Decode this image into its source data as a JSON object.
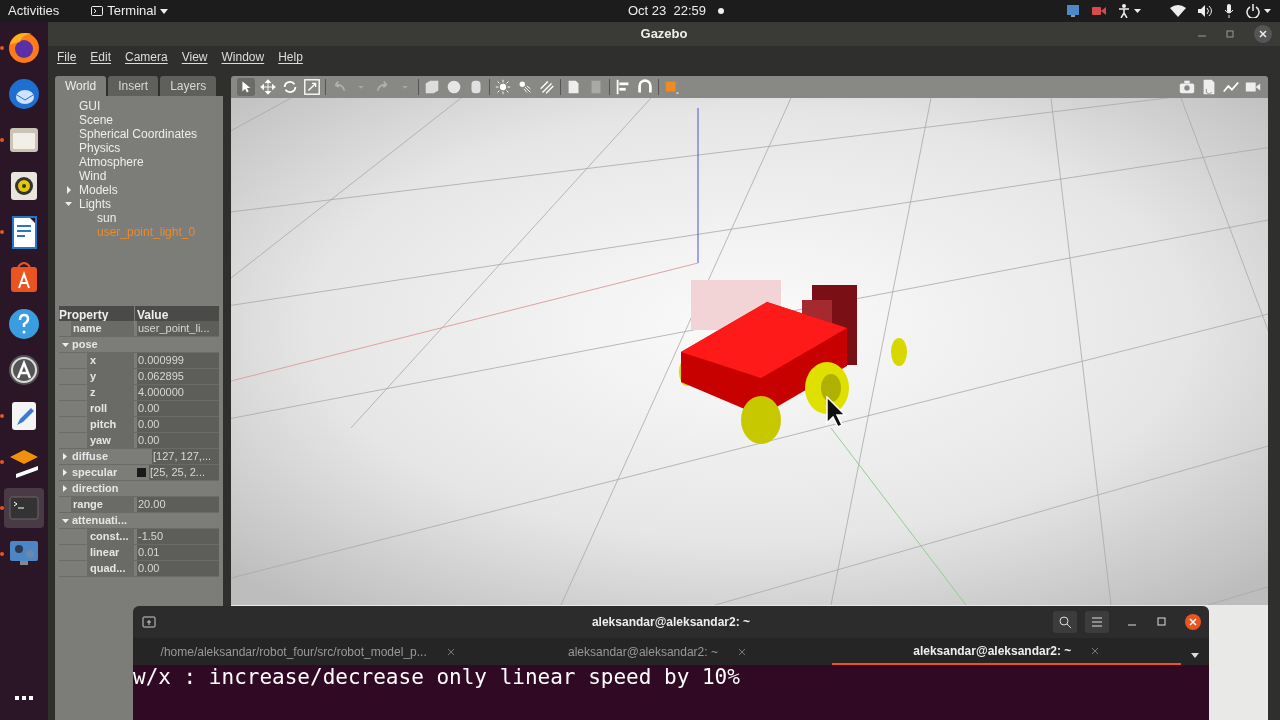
{
  "top_bar": {
    "activities": "Activities",
    "app_menu": "Terminal",
    "clock": "Oct 23  22:59"
  },
  "dock": [
    {
      "kind": "firefox",
      "running": true,
      "active": false
    },
    {
      "kind": "mail",
      "running": false,
      "active": false
    },
    {
      "kind": "files",
      "running": true,
      "active": false
    },
    {
      "kind": "music",
      "running": false,
      "active": false
    },
    {
      "kind": "writer",
      "running": true,
      "active": false
    },
    {
      "kind": "store",
      "running": false,
      "active": false
    },
    {
      "kind": "help",
      "running": false,
      "active": false
    },
    {
      "kind": "updater",
      "running": false,
      "active": false
    },
    {
      "kind": "editor",
      "running": true,
      "active": false
    },
    {
      "kind": "modeler",
      "running": true,
      "active": false
    },
    {
      "kind": "terminal",
      "running": true,
      "active": true
    },
    {
      "kind": "display",
      "running": true,
      "active": false
    }
  ],
  "window": {
    "title": "Gazebo"
  },
  "menu": [
    "File",
    "Edit",
    "Camera",
    "View",
    "Window",
    "Help"
  ],
  "tabs": [
    {
      "label": "World",
      "selected": true
    },
    {
      "label": "Insert",
      "selected": false
    },
    {
      "label": "Layers",
      "selected": false
    }
  ],
  "tree": [
    {
      "label": "GUI",
      "selected": false
    },
    {
      "label": "Scene",
      "selected": false
    },
    {
      "label": "Spherical Coordinates",
      "selected": false
    },
    {
      "label": "Physics",
      "selected": false
    },
    {
      "label": "Atmosphere",
      "selected": false
    },
    {
      "label": "Wind",
      "selected": false
    },
    {
      "label": "Models",
      "selected": false,
      "expanded": false
    },
    {
      "label": "Lights",
      "selected": false,
      "expanded": true,
      "children": [
        {
          "label": "sun",
          "selected": false
        },
        {
          "label": "user_point_light_0",
          "selected": true
        }
      ]
    }
  ],
  "properties": {
    "columns": [
      "Property",
      "Value"
    ],
    "rows": [
      {
        "kind": "field",
        "name": "name",
        "value": "user_point_li..."
      },
      {
        "kind": "group",
        "name": "pose",
        "expanded": true,
        "children": [
          {
            "kind": "field",
            "name": "x",
            "value": "0.000999"
          },
          {
            "kind": "field",
            "name": "y",
            "value": "0.062895"
          },
          {
            "kind": "field",
            "name": "z",
            "value": "4.000000"
          },
          {
            "kind": "field",
            "name": "roll",
            "value": "0.00"
          },
          {
            "kind": "field",
            "name": "pitch",
            "value": "0.00"
          },
          {
            "kind": "field",
            "name": "yaw",
            "value": "0.00"
          }
        ]
      },
      {
        "kind": "group",
        "name": "diffuse",
        "expanded": false,
        "value": "[127, 127,..."
      },
      {
        "kind": "group",
        "name": "specular",
        "expanded": false,
        "value": "[25, 25, 2...",
        "color": "#1a1a1a"
      },
      {
        "kind": "group",
        "name": "direction",
        "expanded": false
      },
      {
        "kind": "field",
        "name": "range",
        "value": "20.00"
      },
      {
        "kind": "group",
        "name": "attenuati...",
        "expanded": true,
        "children": [
          {
            "kind": "field",
            "name": "const...",
            "value": "-1.50"
          },
          {
            "kind": "field",
            "name": "linear",
            "value": "0.01"
          },
          {
            "kind": "field",
            "name": "quad...",
            "value": "0.00"
          }
        ]
      }
    ]
  },
  "terminal": {
    "title": "aleksandar@aleksandar2: ~",
    "tabs": [
      {
        "label": "/home/aleksandar/robot_four/src/robot_model_p...",
        "selected": false
      },
      {
        "label": "aleksandar@aleksandar2: ~",
        "selected": false
      },
      {
        "label": "aleksandar@aleksandar2: ~",
        "selected": true
      }
    ],
    "line": "w/x : increase/decrease only linear speed by 10%"
  }
}
